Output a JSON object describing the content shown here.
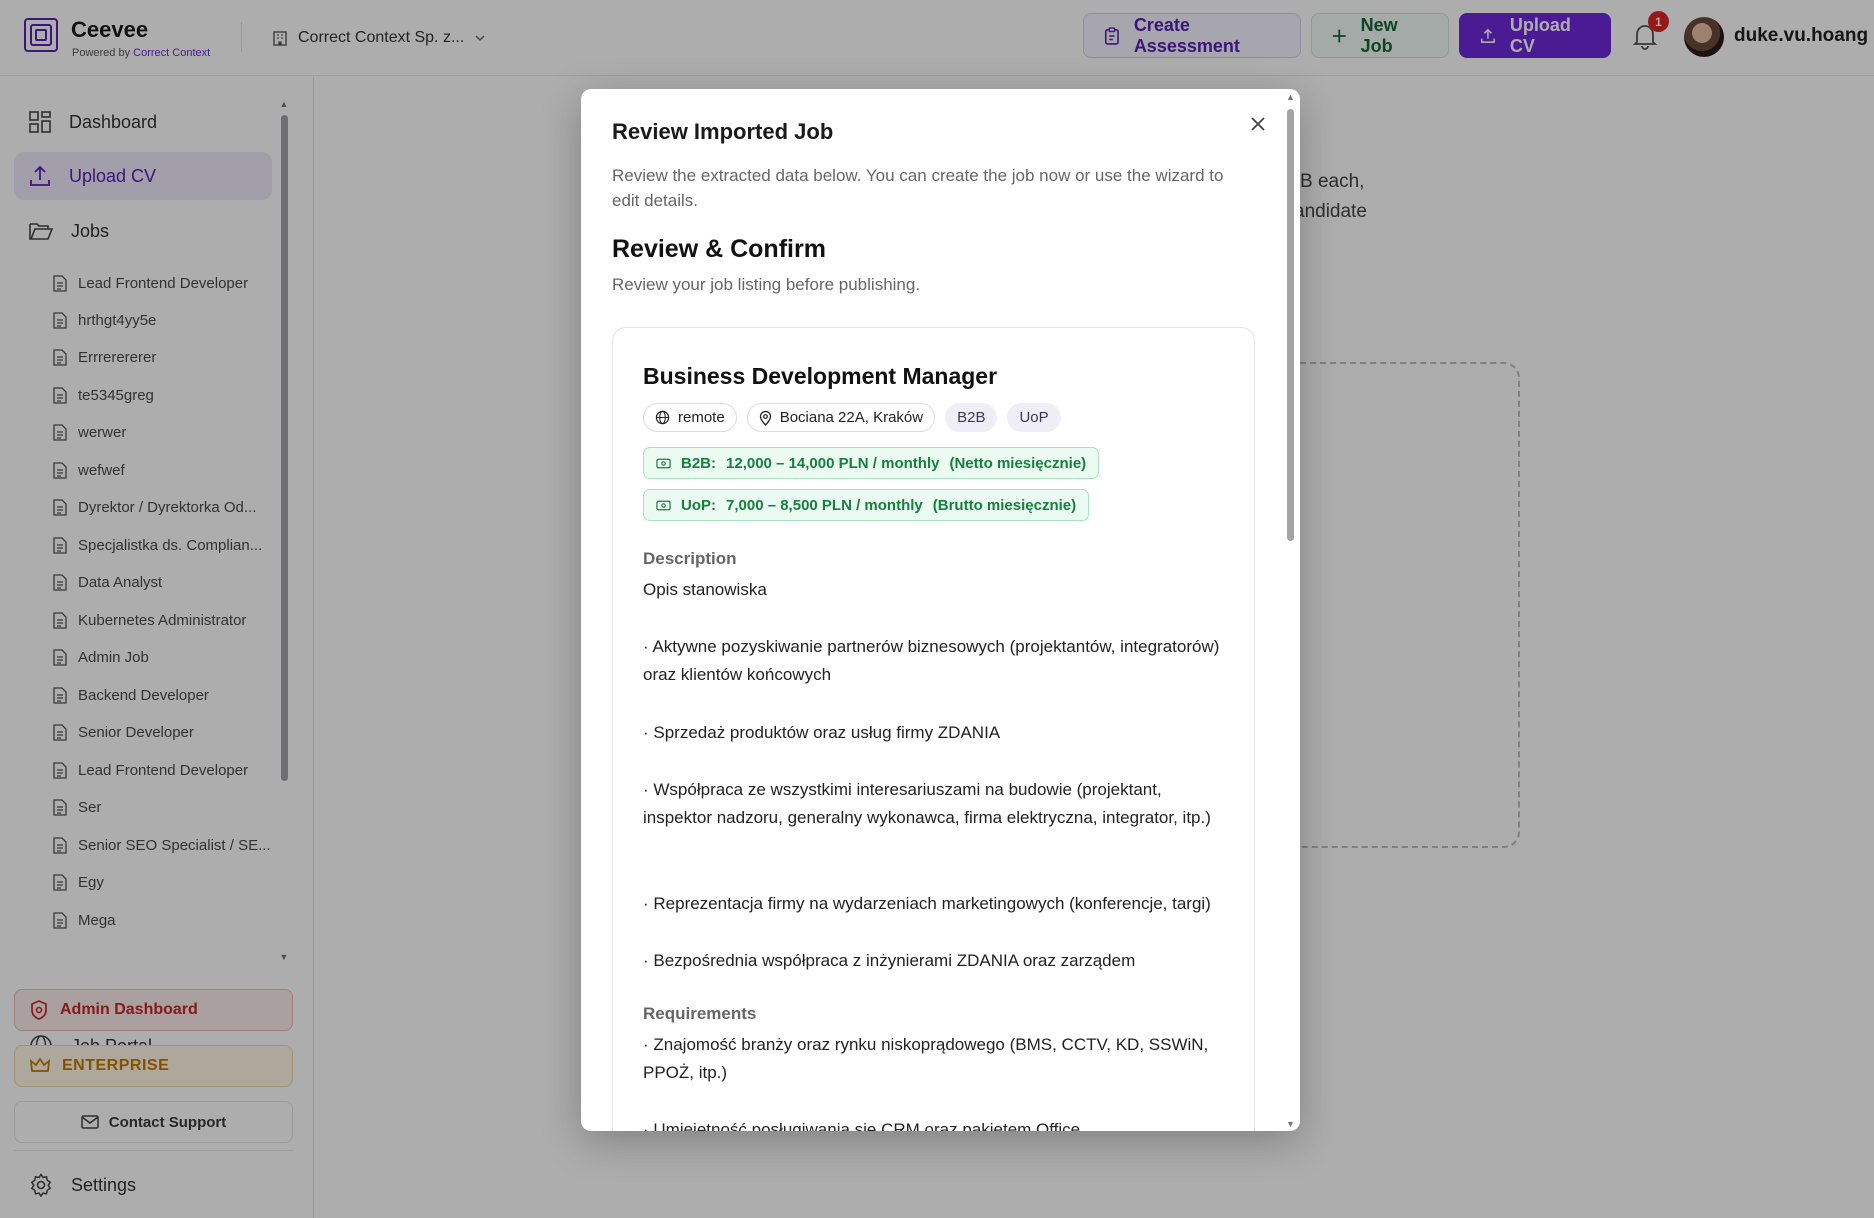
{
  "app": {
    "name": "Ceevee",
    "powered_prefix": "Powered by",
    "powered_brand": "Correct Context",
    "company": "Correct Context Sp. z...",
    "accent_color": "#6d28d9"
  },
  "header": {
    "create_assessment": "Create Assessment",
    "new_job": "New Job",
    "upload_cv": "Upload CV",
    "notifications": "1",
    "username": "duke.vu.hoang"
  },
  "sidebar": {
    "dashboard": "Dashboard",
    "upload_cv": "Upload CV",
    "jobs": "Jobs",
    "job_items": [
      "Lead Frontend Developer",
      "hrthgt4yy5e",
      "Errrerererer",
      "te5345greg",
      "werwer",
      "wefwef",
      "Dyrektor / Dyrektorka Od...",
      "Specjalistka ds. Complian...",
      "Data Analyst",
      "Kubernetes Administrator",
      "Admin Job",
      "Backend Developer",
      "Senior Developer",
      "Lead Frontend Developer",
      "Ser",
      "Senior SEO Specialist / SE...",
      "Egy",
      "Mega"
    ],
    "job_portal": "Job Portal",
    "admin_dashboard": "Admin Dashboard",
    "enterprise": "ENTERPRISE",
    "contact_support": "Contact Support",
    "settings": "Settings"
  },
  "background": {
    "line1": "B each,",
    "line2": "andidate"
  },
  "modal": {
    "title": "Review Imported Job",
    "description": "Review the extracted data below. You can create the job now or use the wizard to edit details.",
    "heading": "Review & Confirm",
    "subheading": "Review your job listing before publishing.",
    "job": {
      "title": "Business Development Manager",
      "work_mode": "remote",
      "location": "Bociana 22A, Kraków",
      "contract_types": [
        "B2B",
        "UoP"
      ],
      "salaries": [
        {
          "label": "B2B:",
          "range": "12,000 – 14,000 PLN / monthly",
          "note": "(Netto miesięcznie)"
        },
        {
          "label": "UoP:",
          "range": "7,000 – 8,500 PLN / monthly",
          "note": "(Brutto miesięcznie)"
        }
      ],
      "description_label": "Description",
      "description_lines": [
        "Opis stanowiska",
        "· Aktywne pozyskiwanie partnerów biznesowych (projektantów, integratorów) oraz klientów końcowych",
        "· Sprzedaż produktów oraz usług firmy ZDANIA",
        "· Współpraca ze wszystkimi interesariuszami na budowie (projektant, inspektor nadzoru, generalny wykonawca, firma elektryczna, integrator, itp.)",
        "· Reprezentacja firmy na wydarzeniach marketingowych (konferencje, targi)",
        "· Bezpośrednia współpraca z inżynierami ZDANIA oraz zarządem"
      ],
      "requirements_label": "Requirements",
      "requirements_lines": [
        "· Znajomość branży oraz rynku niskoprądowego (BMS, CCTV, KD, SSWiN, PPOŻ, itp.)",
        "· Umiejętność posługiwania się CRM oraz pakietem Office"
      ]
    }
  }
}
